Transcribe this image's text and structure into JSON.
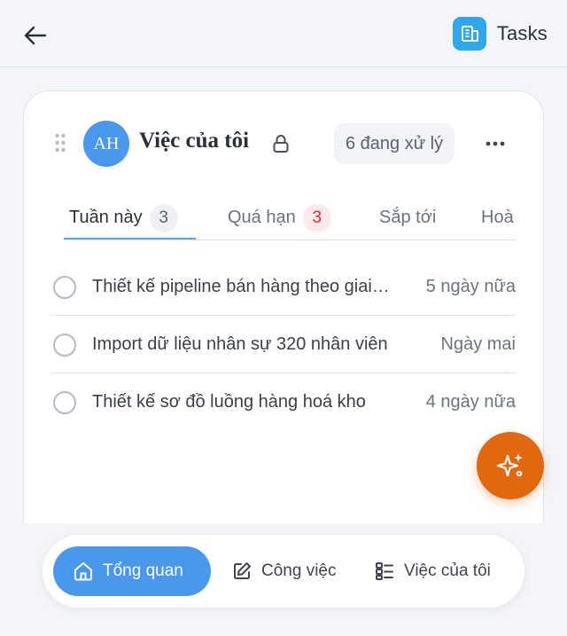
{
  "header": {
    "back_icon": "arrow-left-icon",
    "app_icon": "building-icon",
    "app_name": "Tasks",
    "app_icon_color": "#2fa7ea"
  },
  "card": {
    "avatar_initials": "AH",
    "avatar_color": "#4a97ee",
    "title": "Việc của tôi",
    "lock_icon": "lock-icon",
    "status_pill": "6 đang xử lý",
    "more_icon": "more-horizontal-icon",
    "drag_icon": "drag-handle-icon"
  },
  "tabs": [
    {
      "label": "Tuần này",
      "count": "3",
      "active": true
    },
    {
      "label": "Quá hạn",
      "count": "3",
      "count_color": "#e5283b"
    },
    {
      "label": "Sắp tới"
    },
    {
      "label": "Hoà"
    }
  ],
  "tasks": [
    {
      "title": "Thiết kế pipeline bán hàng theo giai đoạn",
      "due": "5 ngày nữa"
    },
    {
      "title": "Import dữ liệu nhân sự 320 nhân viên",
      "due": "Ngày mai"
    },
    {
      "title": "Thiết kế sơ đồ luồng hàng hoá kho",
      "due": "4 ngày nữa"
    }
  ],
  "fab": {
    "icon": "sparkles-icon",
    "color": "#e2680f"
  },
  "bottom_nav": [
    {
      "label": "Tổng quan",
      "icon": "home-icon",
      "active": true
    },
    {
      "label": "Công việc",
      "icon": "edit-icon"
    },
    {
      "label": "Việc của tôi",
      "icon": "list-icon"
    }
  ]
}
